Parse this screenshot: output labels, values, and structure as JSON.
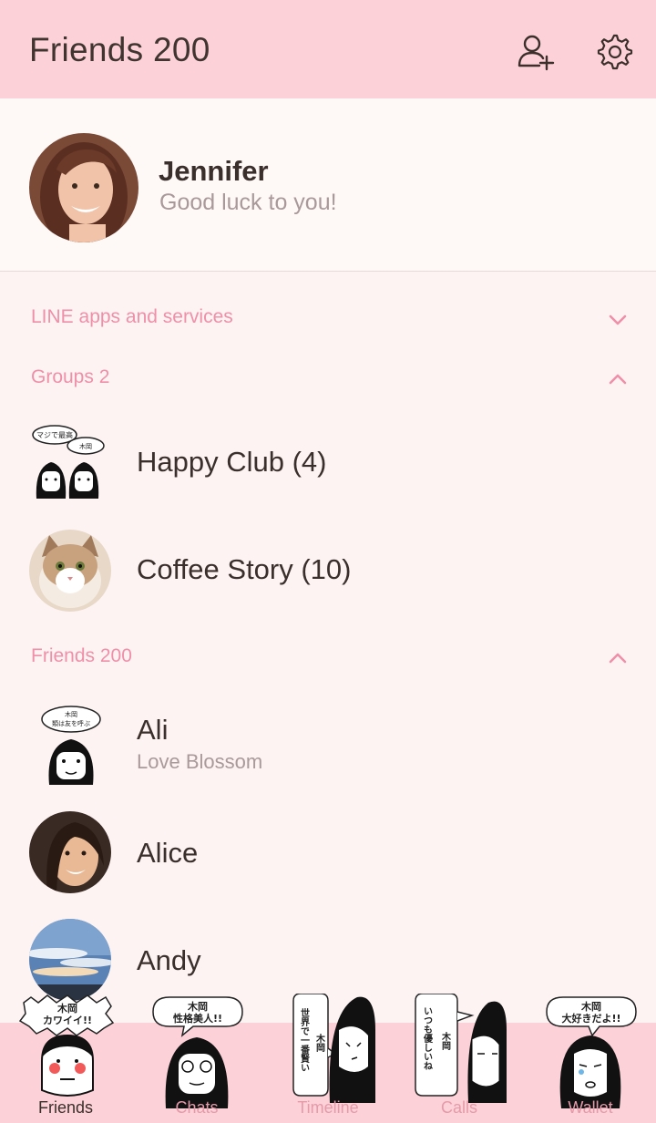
{
  "header": {
    "title": "Friends 200"
  },
  "profile": {
    "name": "Jennifer",
    "status": "Good luck to you!"
  },
  "sections": {
    "line_apps": "LINE apps and services",
    "groups": "Groups 2",
    "friends": "Friends 200"
  },
  "groups": [
    {
      "name": "Happy Club (4)"
    },
    {
      "name": "Coffee Story (10)"
    }
  ],
  "friends": [
    {
      "name": "Ali",
      "status": "Love Blossom"
    },
    {
      "name": "Alice"
    },
    {
      "name": "Andy"
    }
  ],
  "tabs": [
    {
      "label": "Friends",
      "active": true,
      "bubble": "木岡\nカワイイ!!"
    },
    {
      "label": "Chats",
      "bubble": "木岡\n性格美人!!"
    },
    {
      "label": "Timeline",
      "bubble": "世界で一番賢い木岡"
    },
    {
      "label": "Calls",
      "bubble": "いつも優しいね木岡"
    },
    {
      "label": "Wallet",
      "bubble": "木岡\n大好きだよ!!"
    }
  ],
  "stickers": {
    "happy_club": "マジで最高 木岡",
    "ali": "木岡 類は友を呼ぶ"
  },
  "colors": {
    "header_bg": "#fdd1d8",
    "accent": "#ef8fa8",
    "body_bg": "#fdf3f3"
  }
}
